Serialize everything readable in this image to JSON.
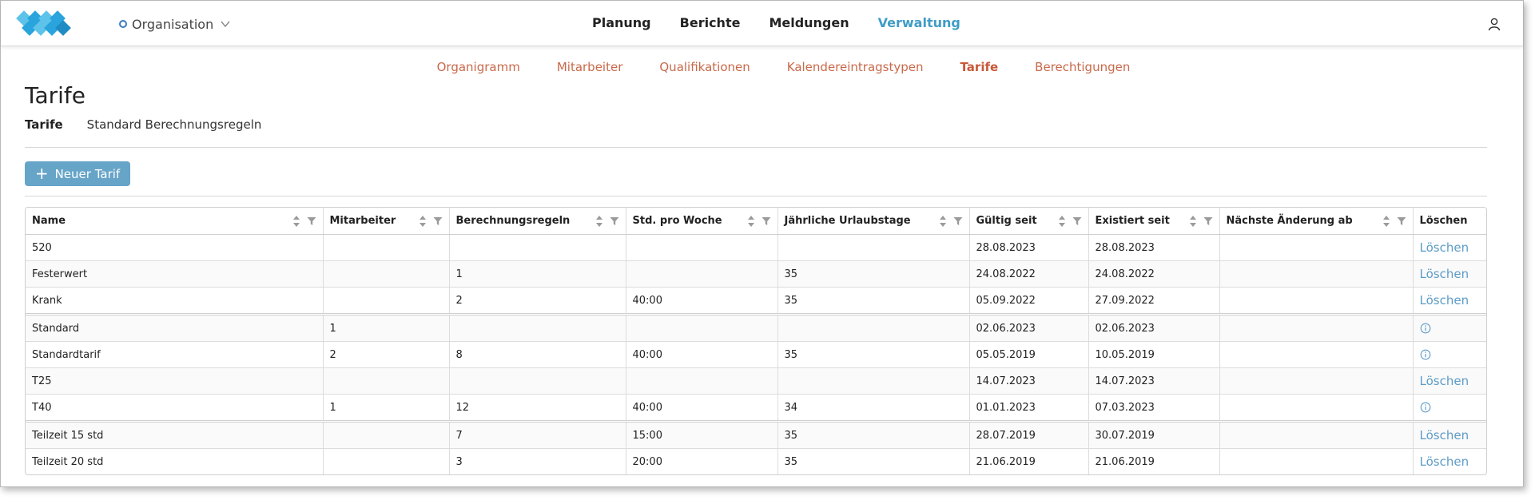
{
  "header": {
    "org_label": "Organisation",
    "main_nav": [
      {
        "label": "Planung",
        "active": false
      },
      {
        "label": "Berichte",
        "active": false
      },
      {
        "label": "Meldungen",
        "active": false
      },
      {
        "label": "Verwaltung",
        "active": true
      }
    ],
    "accent_color": "#3f9cc6"
  },
  "subnav": [
    {
      "label": "Organigramm",
      "active": false
    },
    {
      "label": "Mitarbeiter",
      "active": false
    },
    {
      "label": "Qualifikationen",
      "active": false
    },
    {
      "label": "Kalendereintragstypen",
      "active": false
    },
    {
      "label": "Tarife",
      "active": true
    },
    {
      "label": "Berechtigungen",
      "active": false
    }
  ],
  "page": {
    "title": "Tarife",
    "breadcrumb_active": "Tarife",
    "breadcrumb_link": "Standard Berechnungsregeln"
  },
  "toolbar": {
    "new_button_label": "Neuer Tarif"
  },
  "table": {
    "columns": [
      {
        "label": "Name",
        "sortable": true
      },
      {
        "label": "Mitarbeiter",
        "sortable": true
      },
      {
        "label": "Berechnungsregeln",
        "sortable": true
      },
      {
        "label": "Std. pro Woche",
        "sortable": true
      },
      {
        "label": "Jährliche Urlaubstage",
        "sortable": true
      },
      {
        "label": "Gültig seit",
        "sortable": true
      },
      {
        "label": "Existiert seit",
        "sortable": true
      },
      {
        "label": "Nächste Änderung ab",
        "sortable": true
      },
      {
        "label": "Löschen",
        "sortable": false
      }
    ],
    "delete_label": "Löschen",
    "rows": [
      {
        "cells": [
          "520",
          "",
          "",
          "",
          "",
          "28.08.2023",
          "28.08.2023",
          ""
        ],
        "action": "delete"
      },
      {
        "cells": [
          "Festerwert",
          "",
          "1",
          "",
          "35",
          "24.08.2022",
          "24.08.2022",
          ""
        ],
        "action": "delete"
      },
      {
        "cells": [
          "Krank",
          "",
          "2",
          "40:00",
          "35",
          "05.09.2022",
          "27.09.2022",
          ""
        ],
        "action": "delete"
      },
      {
        "cells": [
          "Standard",
          "1",
          "",
          "",
          "",
          "02.06.2023",
          "02.06.2023",
          ""
        ],
        "action": "info"
      },
      {
        "cells": [
          "Standardtarif",
          "2",
          "8",
          "40:00",
          "35",
          "05.05.2019",
          "10.05.2019",
          ""
        ],
        "action": "info"
      },
      {
        "cells": [
          "T25",
          "",
          "",
          "",
          "",
          "14.07.2023",
          "14.07.2023",
          ""
        ],
        "action": "delete"
      },
      {
        "cells": [
          "T40",
          "1",
          "12",
          "40:00",
          "34",
          "01.01.2023",
          "07.03.2023",
          ""
        ],
        "action": "info"
      },
      {
        "cells": [
          "Teilzeit 15 std",
          "",
          "7",
          "15:00",
          "35",
          "28.07.2019",
          "30.07.2019",
          ""
        ],
        "action": "delete"
      },
      {
        "cells": [
          "Teilzeit 20 std",
          "",
          "3",
          "20:00",
          "35",
          "21.06.2019",
          "21.06.2019",
          ""
        ],
        "action": "delete"
      }
    ]
  }
}
